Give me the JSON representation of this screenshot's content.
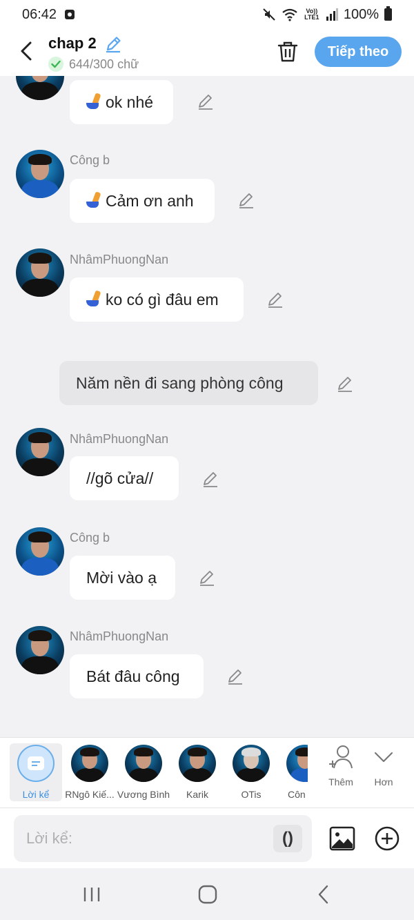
{
  "status_bar": {
    "time": "06:42",
    "network": "Vo)) LTE1",
    "battery": "100%"
  },
  "header": {
    "title": "chap 2",
    "word_count": "644/300 chữ",
    "next_label": "Tiếp theo"
  },
  "messages": [
    {
      "kind": "dialogue",
      "sender": "",
      "text": "ok nhé",
      "phone_emoji": true
    },
    {
      "kind": "dialogue",
      "sender": "Công b",
      "text": "Cảm ơn anh",
      "phone_emoji": true
    },
    {
      "kind": "dialogue",
      "sender": "NhâmPhuongNan",
      "text": "ko có gì đâu em",
      "phone_emoji": true
    },
    {
      "kind": "narration",
      "text": "Năm nền đi sang phòng công"
    },
    {
      "kind": "dialogue",
      "sender": "NhâmPhuongNan",
      "text": "//gõ cửa//",
      "phone_emoji": false
    },
    {
      "kind": "dialogue",
      "sender": "Công b",
      "text": "Mời vào ạ",
      "phone_emoji": false
    },
    {
      "kind": "dialogue",
      "sender": "NhâmPhuongNan",
      "text": "Bát đâu công",
      "phone_emoji": false
    }
  ],
  "characters": [
    {
      "label": "Lời kể",
      "selected": true
    },
    {
      "label": "RNgô Kiế..."
    },
    {
      "label": "Vương Bình"
    },
    {
      "label": "Karik"
    },
    {
      "label": "OTis"
    },
    {
      "label": "Côn"
    }
  ],
  "tools": {
    "add_label": "Thêm",
    "more_label": "Hơn"
  },
  "composer": {
    "placeholder": "Lời kể:",
    "paren_label": "()"
  },
  "icons": {
    "back": "chevron-left-icon",
    "edit": "pencil-icon",
    "delete": "trash-icon",
    "verified": "check-circle-icon",
    "image": "image-icon",
    "add": "plus-circle-icon",
    "add_character": "add-person-icon",
    "more": "chevron-down-icon"
  },
  "colors": {
    "accent": "#5aa6ee",
    "selected_label": "#3b8fe0",
    "check": "#3cb553",
    "background": "#f2f2f4"
  }
}
